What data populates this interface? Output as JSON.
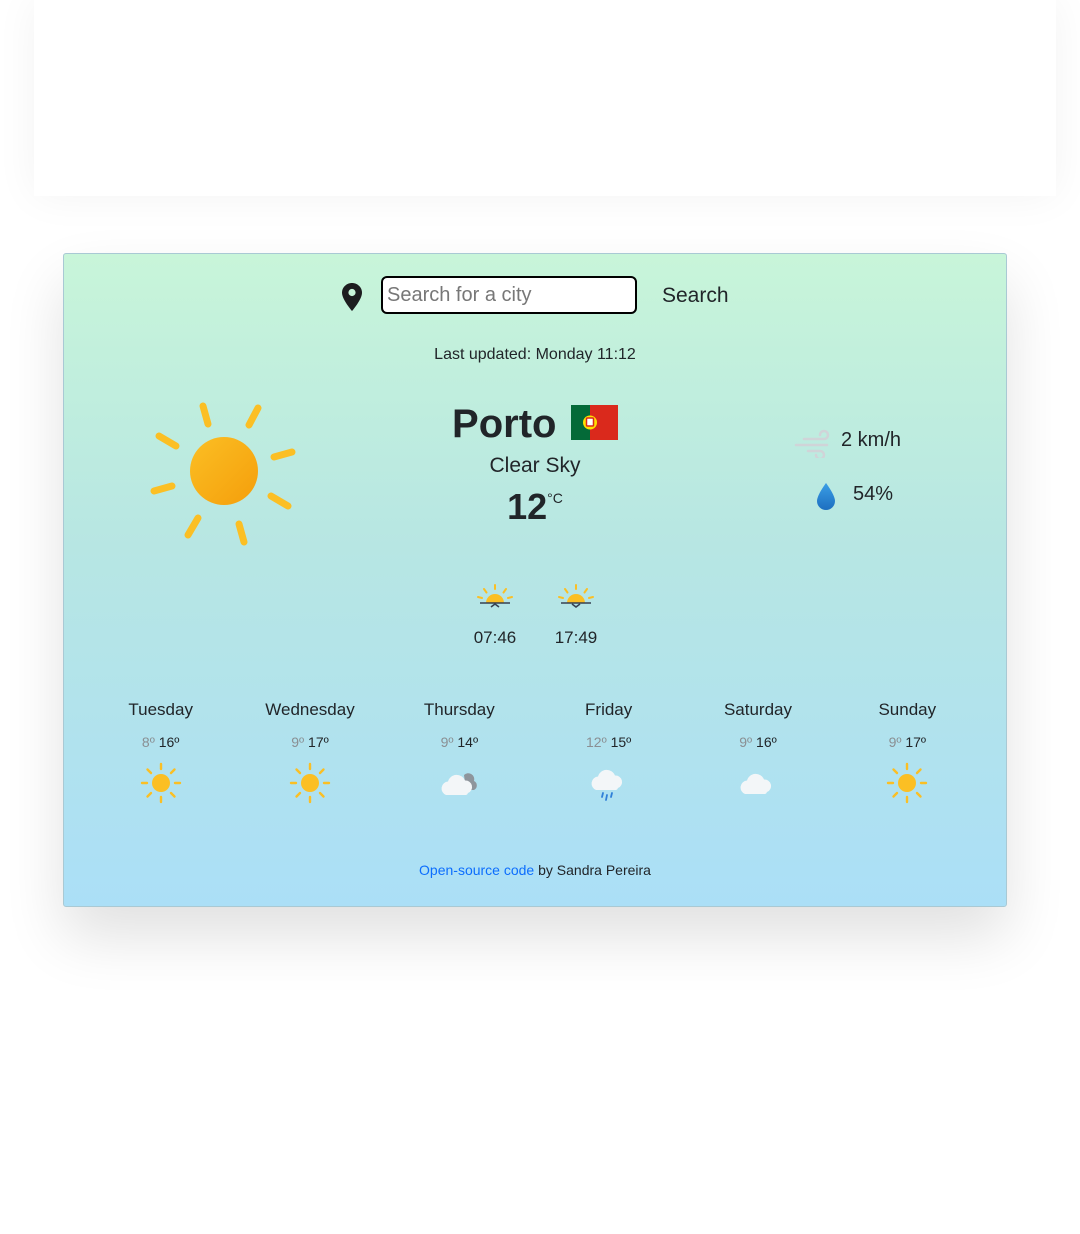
{
  "search": {
    "placeholder": "Search for a city",
    "value": "",
    "button_label": "Search"
  },
  "last_updated": "Last updated: Monday 11:12",
  "current": {
    "city": "Porto",
    "flag": "Portugal flag",
    "description": "Clear Sky",
    "temperature": "12",
    "unit": "°C",
    "icon": "sun-icon",
    "wind": "2 km/h",
    "humidity": "54%"
  },
  "sun": {
    "sunrise": "07:46",
    "sunset": "17:49"
  },
  "forecast": [
    {
      "day": "Tuesday",
      "min": "8º",
      "max": "16º",
      "icon": "sun-icon"
    },
    {
      "day": "Wednesday",
      "min": "9º",
      "max": "17º",
      "icon": "sun-icon"
    },
    {
      "day": "Thursday",
      "min": "9º",
      "max": "14º",
      "icon": "cloudy-icon"
    },
    {
      "day": "Friday",
      "min": "12º",
      "max": "15º",
      "icon": "rain-icon"
    },
    {
      "day": "Saturday",
      "min": "9º",
      "max": "16º",
      "icon": "cloud-icon"
    },
    {
      "day": "Sunday",
      "min": "9º",
      "max": "17º",
      "icon": "sun-icon"
    }
  ],
  "footer": {
    "link_text": "Open-source code",
    "author_text": " by Sandra Pereira"
  },
  "colors": {
    "sun": "#fbbf24",
    "link": "#0d6efd",
    "flag_green": "#046a38",
    "flag_red": "#da291c"
  }
}
